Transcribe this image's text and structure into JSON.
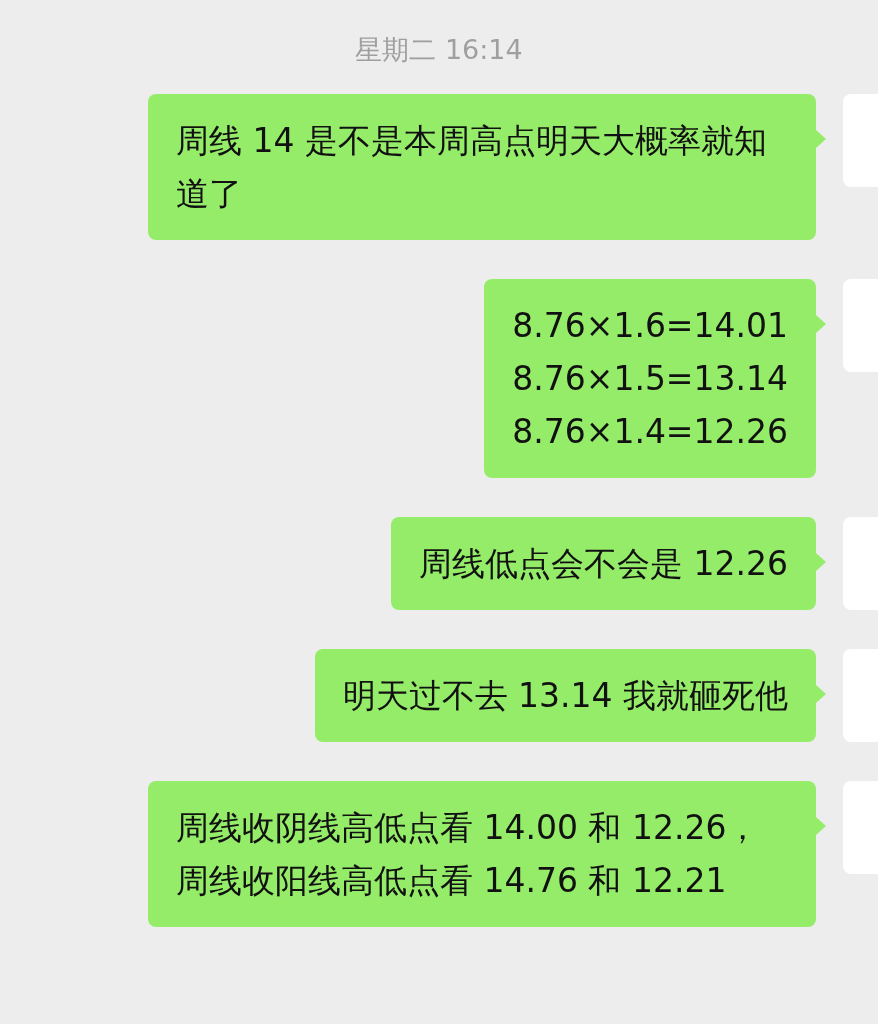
{
  "timestamp": "星期二 16:14",
  "messages": [
    {
      "text": "周线 14 是不是本周高点明天大概率就知道了"
    },
    {
      "text": "8.76×1.6=14.01\n8.76×1.5=13.14\n8.76×1.4=12.26"
    },
    {
      "text": "周线低点会不会是 12.26"
    },
    {
      "text": "明天过不去 13.14 我就砸死他"
    },
    {
      "text": "周线收阴线高低点看 14.00 和 12.26，周线收阳线高低点看 14.76 和 12.21"
    }
  ]
}
